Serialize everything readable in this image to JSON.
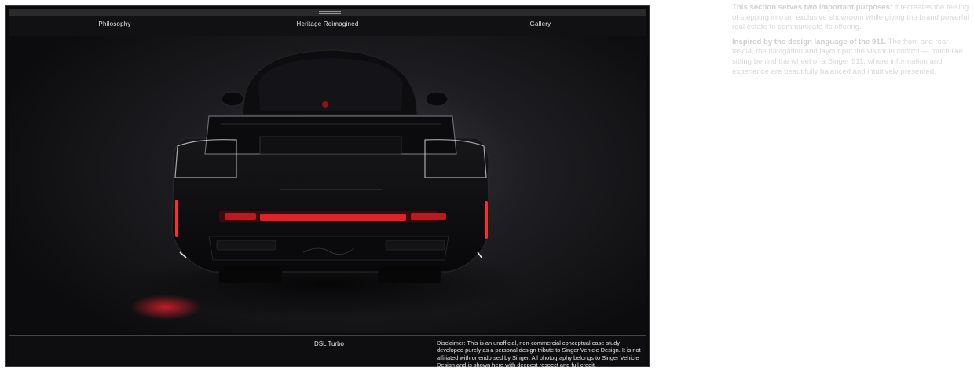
{
  "nav": {
    "items": [
      "Philosophy",
      "Heritage Reimagined",
      "Gallery"
    ]
  },
  "hero": {
    "alt": "Rear view of a black Singer-reimagined Porsche 911 with glowing red taillights in a dark studio"
  },
  "footer": {
    "model": "DSL Turbo",
    "disclaimer": "Disclaimer: This is an unofficial, non-commercial conceptual case study developed purely as a personal design tribute to Singer Vehicle Design. It is not affiliated with or endorsed by Singer. All photography belongs to Singer Vehicle Design and is shown here with deepest respect and full credit."
  },
  "notes": {
    "p1_bold": "This section serves two important purposes:",
    "p1_text": " it recreates the feeling of stepping into an exclusive showroom while giving the brand powerful real estate to communicate its offering.",
    "p2_bold": "Inspired by the design language of the 911.",
    "p2_text": " The front and rear fascia, the navigation and layout put the visitor in control — much like sitting behind the wheel of a Singer 911, where information and experience are beautifully balanced and intuitively presented."
  },
  "colors": {
    "frame_bg": "#0b0b0d",
    "taillight": "#e0202a",
    "side_text": "#d8d8d8"
  }
}
